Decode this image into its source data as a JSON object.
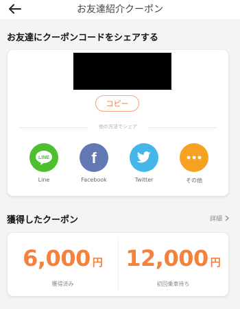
{
  "header": {
    "title": "お友達紹介クーポン"
  },
  "share_section": {
    "title": "お友達にクーポンコードをシェアする",
    "copy_label": "コピー",
    "divider_text": "他の方法でシェア",
    "options": [
      {
        "label": "Line",
        "icon": "line-icon",
        "color": "#4cc02f"
      },
      {
        "label": "Facebook",
        "icon": "facebook-icon",
        "color": "#6279b3"
      },
      {
        "label": "Twitter",
        "icon": "twitter-icon",
        "color": "#45b6ea"
      },
      {
        "label": "その他",
        "icon": "more-icon",
        "color": "#f5a122"
      }
    ]
  },
  "coupon_section": {
    "title": "獲得したクーポン",
    "details_label": "詳細",
    "items": [
      {
        "amount": "6,000",
        "unit": "円",
        "caption": "獲得済み"
      },
      {
        "amount": "12,000",
        "unit": "円",
        "caption": "初回乗車待ち"
      }
    ]
  },
  "colors": {
    "accent": "#f4823d"
  }
}
